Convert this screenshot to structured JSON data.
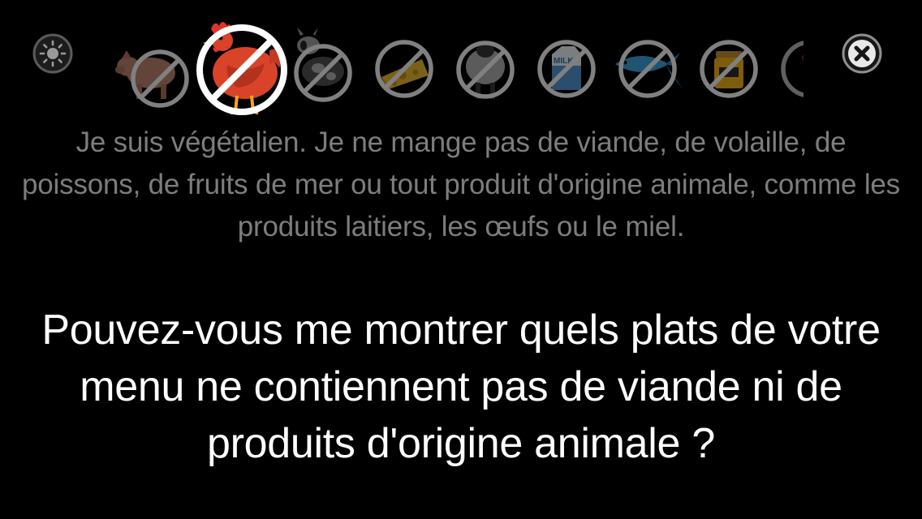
{
  "toolbar": {
    "brightness_icon": "sun-icon",
    "close_icon": "close-x-icon"
  },
  "diet_icons": [
    {
      "name": "pig-icon",
      "selected": false
    },
    {
      "name": "chicken-icon",
      "selected": true
    },
    {
      "name": "cow-icon",
      "selected": false
    },
    {
      "name": "cheese-icon",
      "selected": false
    },
    {
      "name": "sheep-icon",
      "selected": false
    },
    {
      "name": "milk-icon",
      "selected": false
    },
    {
      "name": "fish-icon",
      "selected": false
    },
    {
      "name": "honey-icon",
      "selected": false
    },
    {
      "name": "partial-icon",
      "selected": false
    }
  ],
  "milk_carton_text": "MILK",
  "description": "Je suis végétalien. Je ne mange pas de viande, de volaille, de poissons, de fruits de mer ou tout produit d'origine animale, comme les produits laitiers, les œufs ou le miel.",
  "question": "Pouvez-vous me montrer quels plats de votre menu ne contiennent pas de viande ni de produits d'origine animale ?",
  "colors": {
    "background": "#000000",
    "description_text": "#7d7d7d",
    "question_text": "#ffffff",
    "icon_ring_dim": "#8a8a8a",
    "icon_ring_selected": "#ffffff",
    "chicken": "#d8432a"
  }
}
